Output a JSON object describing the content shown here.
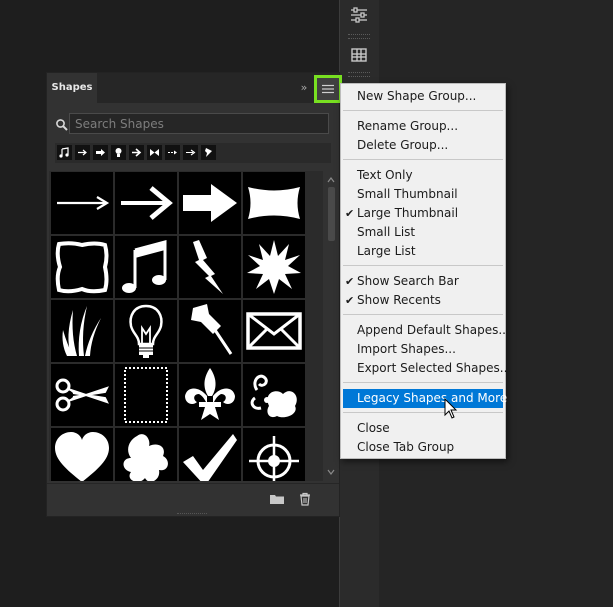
{
  "panel": {
    "tab_label": "Shapes",
    "collapse_icon": "double-chevron-right-icon",
    "menu_icon": "hamburger-menu-icon",
    "menu_button_highlight_color": "#78e021"
  },
  "search": {
    "placeholder": "Search Shapes",
    "icon": "search-icon"
  },
  "recents": [
    "music-note-icon",
    "arrow-right-icon",
    "arrow-right-icon",
    "lightbulb-icon",
    "arrow-right-icon",
    "bowtie-icon",
    "arrow-right-icon",
    "arrow-right-icon",
    "pushpin-icon"
  ],
  "shapes": [
    "arrow-thin-icon",
    "arrow-chevron-icon",
    "arrow-block-icon",
    "banner-icon",
    "frame-icon",
    "music-note-icon",
    "lightning-icon",
    "starburst-icon",
    "grass-icon",
    "lightbulb-icon",
    "pushpin-icon",
    "envelope-icon",
    "scissors-icon",
    "stamp-frame-icon",
    "fleur-de-lis-icon",
    "ornament-icon",
    "heart-icon",
    "blob-icon",
    "checkmark-icon",
    "target-icon"
  ],
  "footer": {
    "folder_icon": "folder-icon",
    "trash_icon": "trash-icon"
  },
  "menu": {
    "items": [
      {
        "label": "New Shape Group...",
        "checked": false
      },
      {
        "label": "Rename Group...",
        "checked": false
      },
      {
        "label": "Delete Group...",
        "checked": false
      },
      {
        "label": "Text Only",
        "checked": false
      },
      {
        "label": "Small Thumbnail",
        "checked": false
      },
      {
        "label": "Large Thumbnail",
        "checked": true
      },
      {
        "label": "Small List",
        "checked": false
      },
      {
        "label": "Large List",
        "checked": false
      },
      {
        "label": "Show Search Bar",
        "checked": true
      },
      {
        "label": "Show Recents",
        "checked": true
      },
      {
        "label": "Append Default Shapes...",
        "checked": false
      },
      {
        "label": "Import Shapes...",
        "checked": false
      },
      {
        "label": "Export Selected Shapes...",
        "checked": false
      },
      {
        "label": "Legacy Shapes and More",
        "checked": false,
        "highlighted": true
      },
      {
        "label": "Close",
        "checked": false
      },
      {
        "label": "Close Tab Group",
        "checked": false
      }
    ],
    "check_glyph": "✔",
    "highlight_color": "#0078d7"
  },
  "dock": {
    "icons": [
      "sliders-icon",
      "grid-icon"
    ]
  }
}
